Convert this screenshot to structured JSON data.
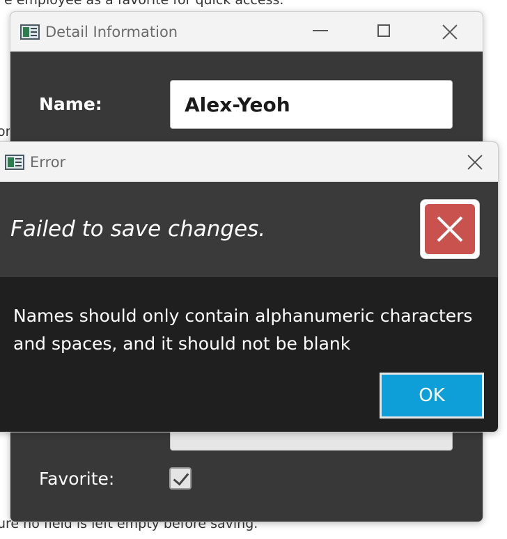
{
  "background": {
    "top_text": "e employee as a favorite for quick access.",
    "left_fragment": "or",
    "bottom_text": "ure no field is left empty before saving."
  },
  "detail_window": {
    "title": "Detail Information",
    "name_label": "Name:",
    "name_value": "Alex-Yeoh",
    "favorite_label": "Favorite:",
    "favorite_checked": true
  },
  "error_dialog": {
    "title": "Error",
    "header": "Failed to save changes.",
    "message": "Names should only contain alphanumeric characters and spaces, and it should not be blank",
    "ok_label": "OK",
    "icon": "error-x-icon"
  },
  "colors": {
    "ok_button": "#0e9fd8",
    "error_icon": "#c9524e",
    "dialog_body": "#1f1f1f",
    "dialog_header": "#3a3a3a"
  }
}
